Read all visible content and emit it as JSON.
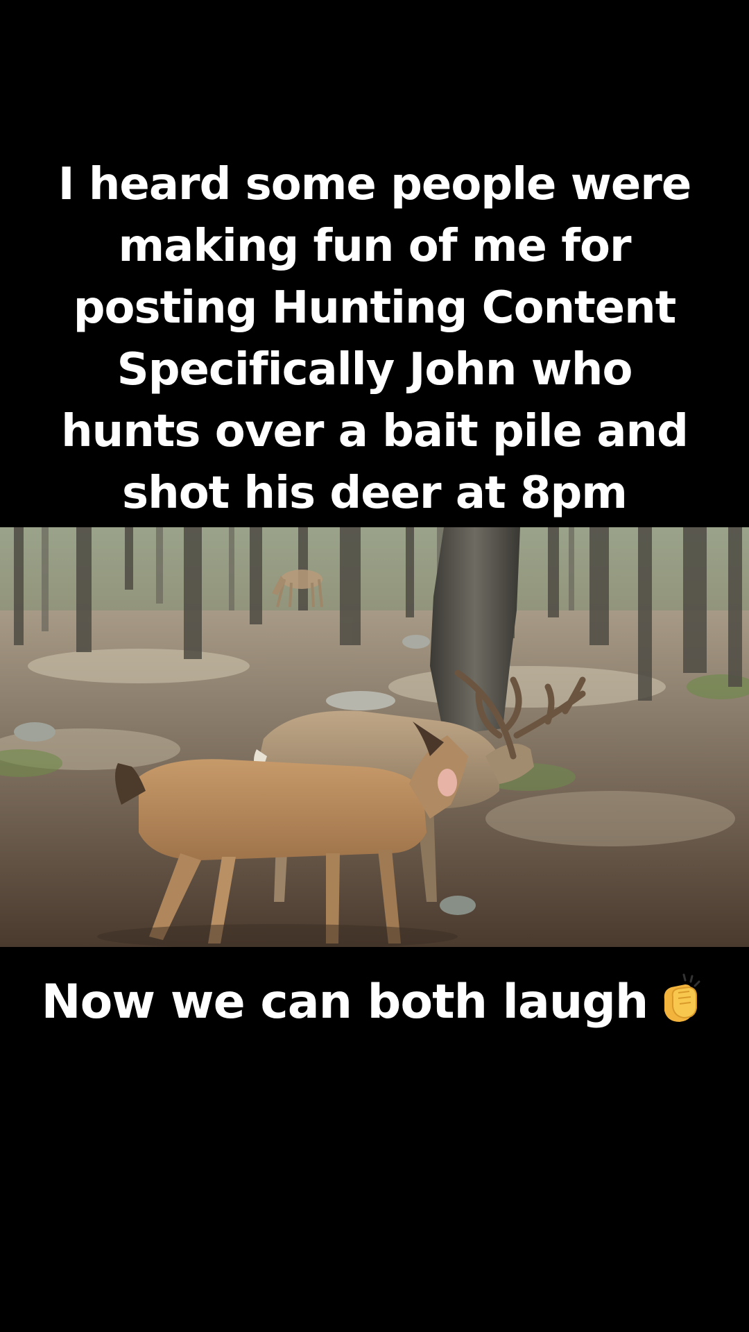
{
  "caption_top": {
    "lines": [
      "I heard some people were",
      "making fun of me for",
      "posting Hunting Content",
      "Specifically John who",
      "hunts over a bait pile and",
      "shot his deer at 8pm"
    ]
  },
  "photo": {
    "description_icon": "trail-camera-photo",
    "subject": "deer-in-forest"
  },
  "caption_bottom": {
    "text": "Now we can both laugh",
    "emoji_icon": "clapping-hands-icon"
  }
}
